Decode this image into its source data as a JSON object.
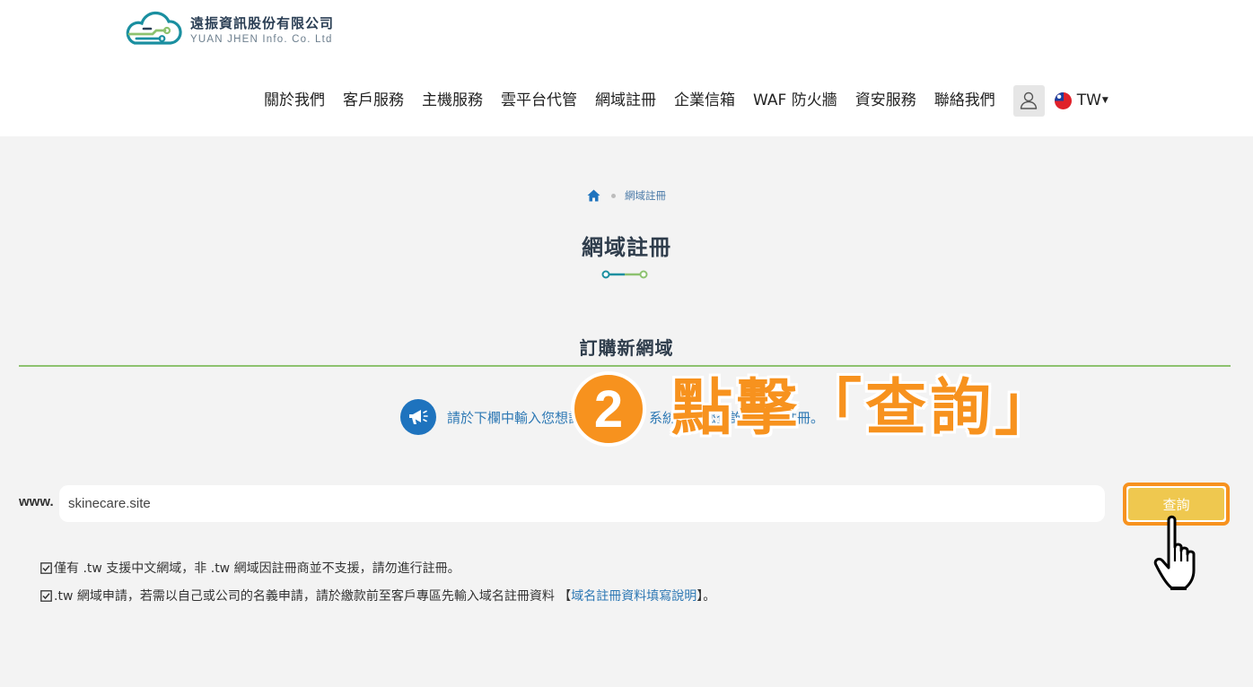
{
  "brand": {
    "name_cn": "遠振資訊股份有限公司",
    "name_en": "YUAN JHEN Info. Co. Ltd",
    "colors": {
      "teal": "#1a8fa0",
      "green": "#8dc26f",
      "navy": "#2b3f55"
    }
  },
  "nav": {
    "items": [
      "關於我們",
      "客戶服務",
      "主機服務",
      "雲平台代管",
      "網域註冊",
      "企業信箱",
      "WAF 防火牆",
      "資安服務",
      "聯絡我們"
    ],
    "language": "TW"
  },
  "breadcrumb": {
    "current": "網域註冊"
  },
  "page": {
    "title": "網域註冊",
    "section_title": "訂購新網域"
  },
  "notice": {
    "text": "請於下欄中輸入您想註冊的網域，系統將為您查詢是否可註冊。"
  },
  "overlay": {
    "step_number": "2",
    "callout": "點擊「查詢」"
  },
  "search": {
    "prefix": "www.",
    "value": "skinecare.site",
    "button_label": "查詢"
  },
  "notes": {
    "note1": "僅有 .tw 支援中文網域，非 .tw 網域因註冊商並不支援，請勿進行註冊。",
    "note2_prefix": ".tw 網域申請，若需以自己或公司的名義申請，請於繳款前至客戶專區先輸入域名註冊資料 【",
    "note2_link": "域名註冊資料填寫說明",
    "note2_suffix": "】。"
  },
  "colors": {
    "accent_orange": "#f7921e",
    "button_yellow": "#efc84f",
    "link_blue": "#2d78b4",
    "divider_green": "#8dc26f"
  }
}
